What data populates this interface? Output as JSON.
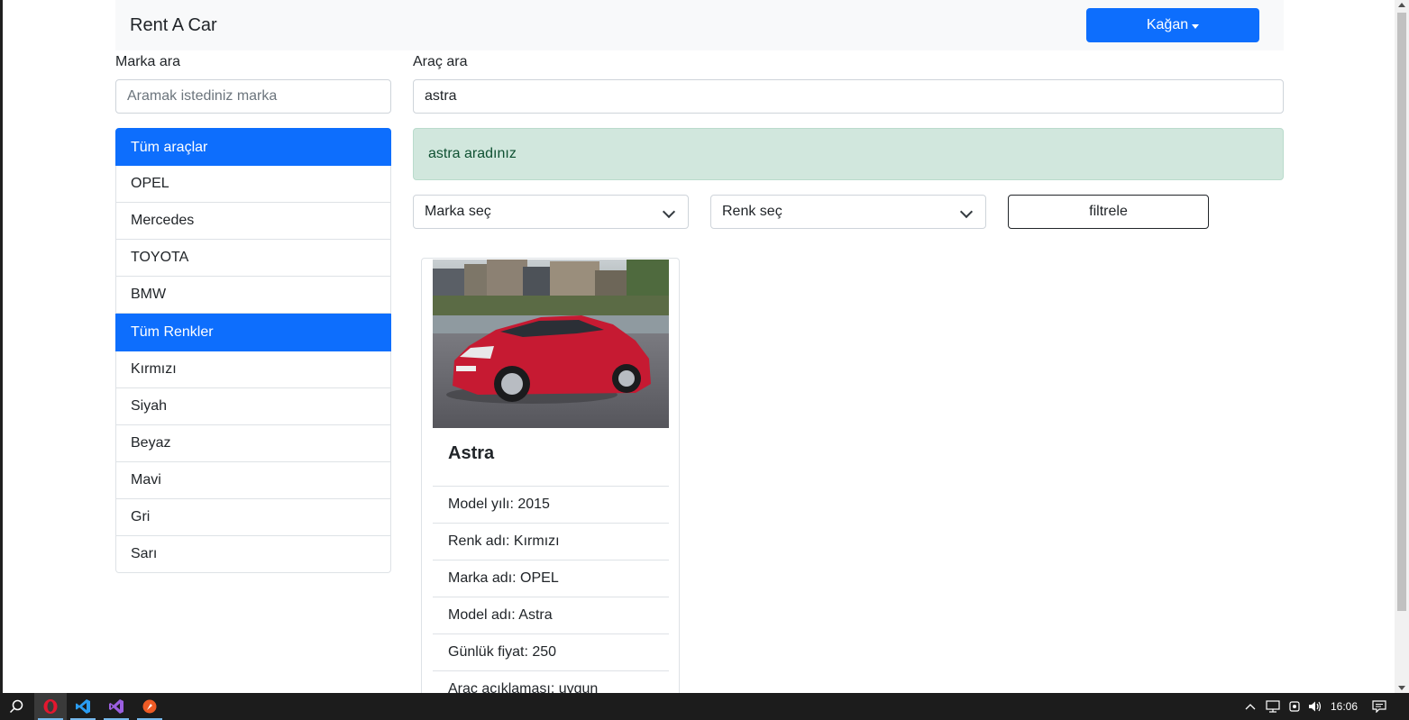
{
  "navbar": {
    "brand": "Rent A Car",
    "user_label": "Kağan"
  },
  "brand_search": {
    "label": "Marka ara",
    "placeholder": "Aramak istediniz marka",
    "value": ""
  },
  "car_search": {
    "label": "Araç ara",
    "value": "astra"
  },
  "brand_list": {
    "header": "Tüm araçlar",
    "items": [
      "OPEL",
      "Mercedes",
      "TOYOTA",
      "BMW"
    ]
  },
  "color_list": {
    "header": "Tüm Renkler",
    "items": [
      "Kırmızı",
      "Siyah",
      "Beyaz",
      "Mavi",
      "Gri",
      "Sarı"
    ]
  },
  "alert": {
    "text": "astra aradınız"
  },
  "filters": {
    "brand_select": "Marka seç",
    "color_select": "Renk seç",
    "filter_button": "filtrele"
  },
  "car_card": {
    "title": "Astra",
    "details": [
      "Model yılı: 2015",
      "Renk adı: Kırmızı",
      "Marka adı: OPEL",
      "Model adı: Astra",
      "Günlük fiyat: 250",
      "Araç açıklaması: uygun"
    ]
  },
  "taskbar": {
    "time": "16:06"
  },
  "colors": {
    "primary": "#0d6efd",
    "alert_bg": "#d1e7dd",
    "alert_text": "#0f5132",
    "navbar_bg": "#f8f9fa"
  }
}
